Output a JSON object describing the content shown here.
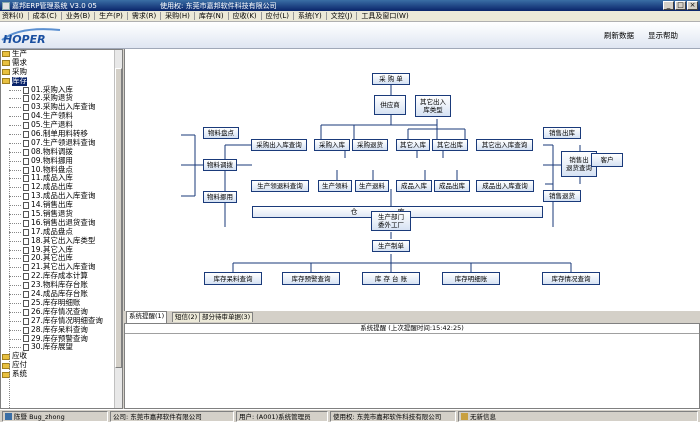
{
  "window": {
    "title": "嘉邦ERP管理系统 V3.0 05",
    "user_info": "使用权: 东莞市嘉邦软件科技有限公司"
  },
  "menu": [
    "资料(I)",
    "成本(C)",
    "业务(B)",
    "生产(P)",
    "需求(R)",
    "采购(H)",
    "库存(N)",
    "应收(K)",
    "应付(L)",
    "系统(Y)",
    "文控(J)",
    "工具及窗口(W)"
  ],
  "header": {
    "logo_text": "HOPER",
    "refresh_label": "刷新数据",
    "show_help_label": "显示帮助"
  },
  "tree": {
    "top_folders": [
      "生产",
      "需求",
      "采购",
      "库存"
    ],
    "items": [
      "01.采购入库",
      "02.采购退货",
      "03.采购出入库查询",
      "04.生产领料",
      "05.生产退料",
      "06.制单用料转移",
      "07.生产领退料查询",
      "08.物料调拨",
      "09.物料挪用",
      "10.物料盘点",
      "11.成品入库",
      "12.成品出库",
      "13.成品出入库查询",
      "14.销售出库",
      "15.销售退货",
      "16.销售出退货查询",
      "17.成品盘点",
      "18.其它出入库类型",
      "19.其它入库",
      "20.其它出库",
      "21.其它出入库查询",
      "22.库存成本计算",
      "23.物料库存台账",
      "24.成品库存台账",
      "25.库存明细账",
      "26.库存情况查询",
      "27.库存情况明细查询",
      "28.库存呆料查询",
      "29.库存预警查询",
      "30.库存展望"
    ],
    "bottom_folders": [
      "应收",
      "应付",
      "系统"
    ]
  },
  "flow": {
    "purchase_order": "采 购 单",
    "supplier": "供应商",
    "other_io_type": "其它出入\n库类型",
    "material_count": "物料盘点",
    "material_transfer": "物料调拨",
    "material_borrow": "物料挪用",
    "purchase_io_query": "采购出入库查询",
    "purchase_in": "采购入库",
    "purchase_return": "采购退货",
    "other_in": "其它入库",
    "other_out": "其它出库",
    "other_io_query": "其它出入库查询",
    "warehouse": "仓库",
    "prod_pick_query": "生产领退料查询",
    "prod_pick": "生产领料",
    "prod_return": "生产退料",
    "product_in": "成品入库",
    "product_out": "成品出库",
    "product_io_query": "成品出入库查询",
    "sales_out": "销售出库",
    "sales_query": "销售出\n退货查询",
    "sales_return": "销售退货",
    "customer": "客户",
    "prod_dept": "生产部门\n委外工厂",
    "prod_order": "生产制单",
    "stock_dead": "库存呆料查询",
    "stock_warn": "库存预警查询",
    "stock_ledger": "库 存 台 账",
    "stock_detail": "库存明细账",
    "stock_status": "库存情况查询"
  },
  "tabs": [
    "系统提醒(1)",
    "短信(2)",
    "部分待审单据(3)"
  ],
  "message": {
    "header": "系统提醒 (上次提醒时间:15:42:25)"
  },
  "status": {
    "user": "陈暨 Bug_zhong",
    "company": "公司: 东莞市嘉邦软件有限公司",
    "login_user": "用户: (A001)系统管理员",
    "license": "使用权: 东莞市嘉邦软件科技有限公司",
    "messages": "无新信息"
  }
}
